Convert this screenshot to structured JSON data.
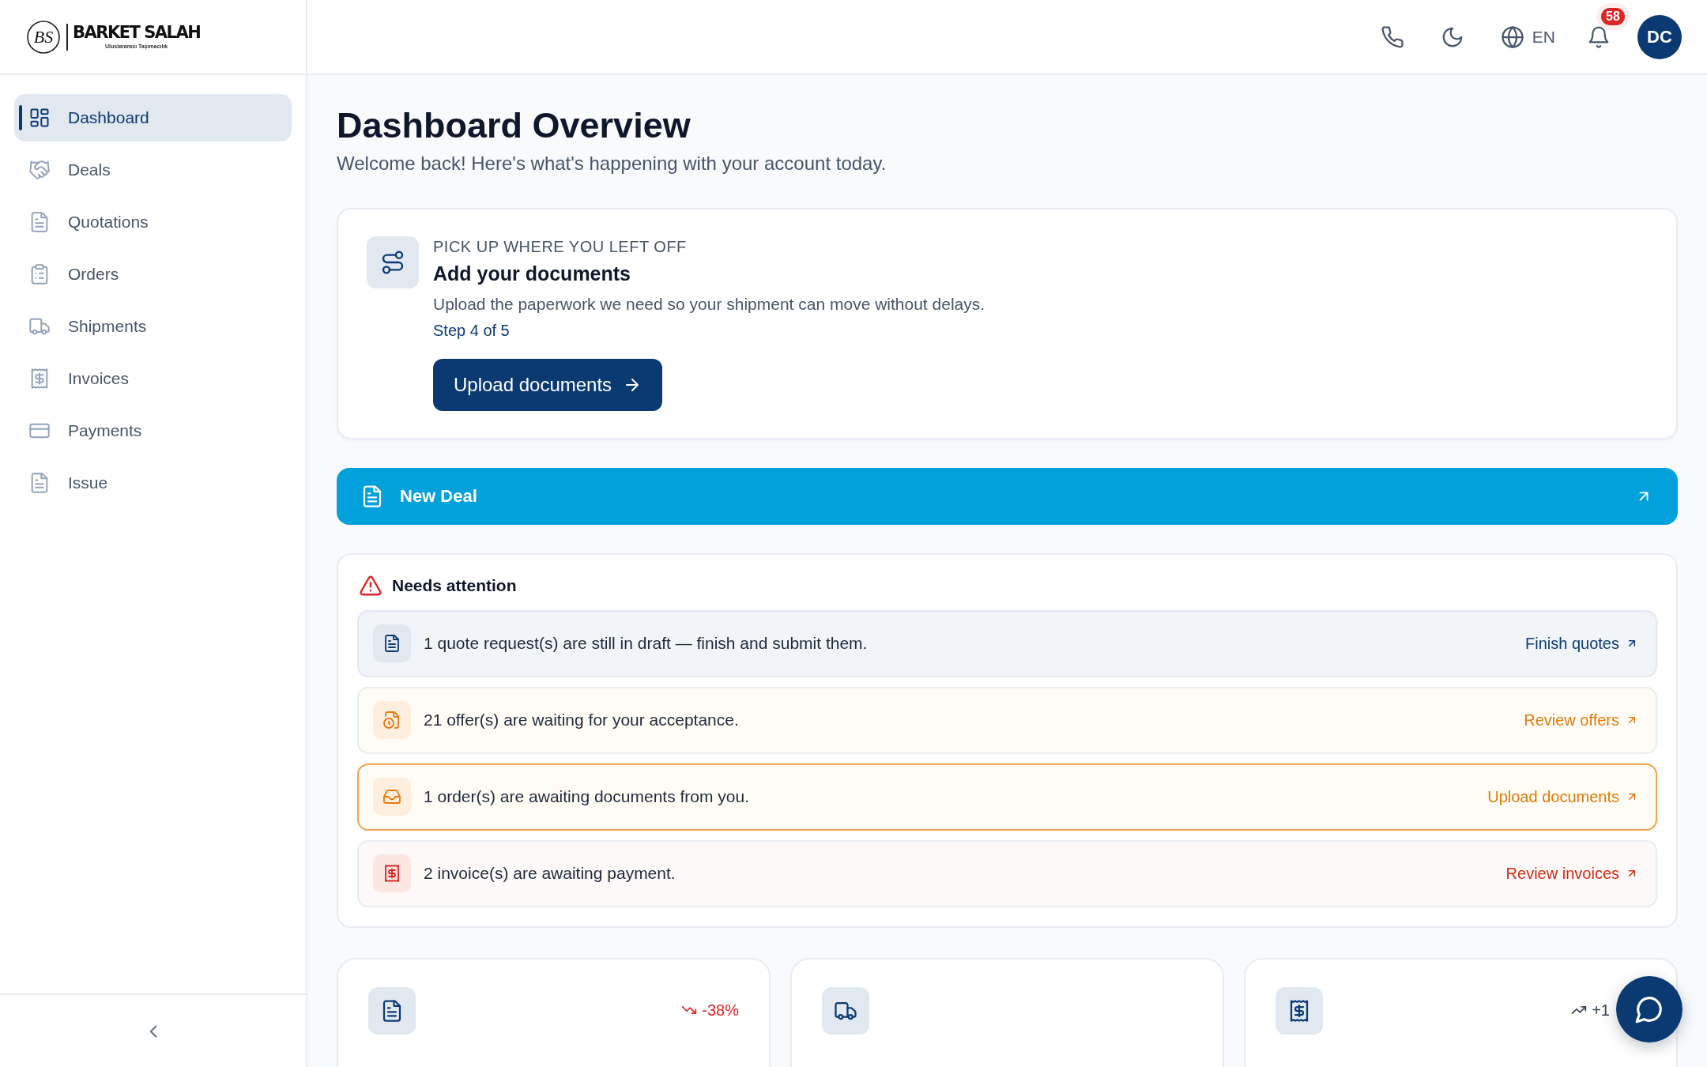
{
  "brand": {
    "monogram": "BS",
    "name": "BARKET SALAH",
    "tagline": "Uluslararası Taşımacılık"
  },
  "topbar": {
    "language": "EN",
    "notifications": "58",
    "avatar": "DC"
  },
  "sidebar": {
    "items": [
      {
        "label": "Dashboard",
        "selected": true
      },
      {
        "label": "Deals",
        "selected": false
      },
      {
        "label": "Quotations",
        "selected": false
      },
      {
        "label": "Orders",
        "selected": false
      },
      {
        "label": "Shipments",
        "selected": false
      },
      {
        "label": "Invoices",
        "selected": false
      },
      {
        "label": "Payments",
        "selected": false
      },
      {
        "label": "Issue",
        "selected": false
      }
    ]
  },
  "header": {
    "title": "Dashboard Overview",
    "subtitle": "Welcome back! Here's what's happening with your account today."
  },
  "resume_card": {
    "eyebrow": "PICK UP WHERE YOU LEFT OFF",
    "title": "Add your documents",
    "text": "Upload the paperwork we need so your shipment can move without delays.",
    "step": "Step 4 of 5",
    "button": "Upload documents"
  },
  "new_deal": {
    "label": "New Deal"
  },
  "attention": {
    "title": "Needs attention",
    "items": [
      {
        "kind": "info",
        "text": "1 quote request(s) are still in draft — finish and submit them.",
        "action": "Finish quotes",
        "highlighted": false
      },
      {
        "kind": "warning",
        "text": "21 offer(s) are waiting for your acceptance.",
        "action": "Review offers",
        "highlighted": false
      },
      {
        "kind": "warning",
        "text": "1 order(s) are awaiting documents from you.",
        "action": "Upload documents",
        "highlighted": true
      },
      {
        "kind": "danger",
        "text": "2 invoice(s) are awaiting payment.",
        "action": "Review invoices",
        "highlighted": false
      }
    ]
  },
  "stats": [
    {
      "kind": "down",
      "change": "-38%"
    },
    {
      "kind": "plain"
    },
    {
      "kind": "up",
      "change": "+1"
    }
  ]
}
